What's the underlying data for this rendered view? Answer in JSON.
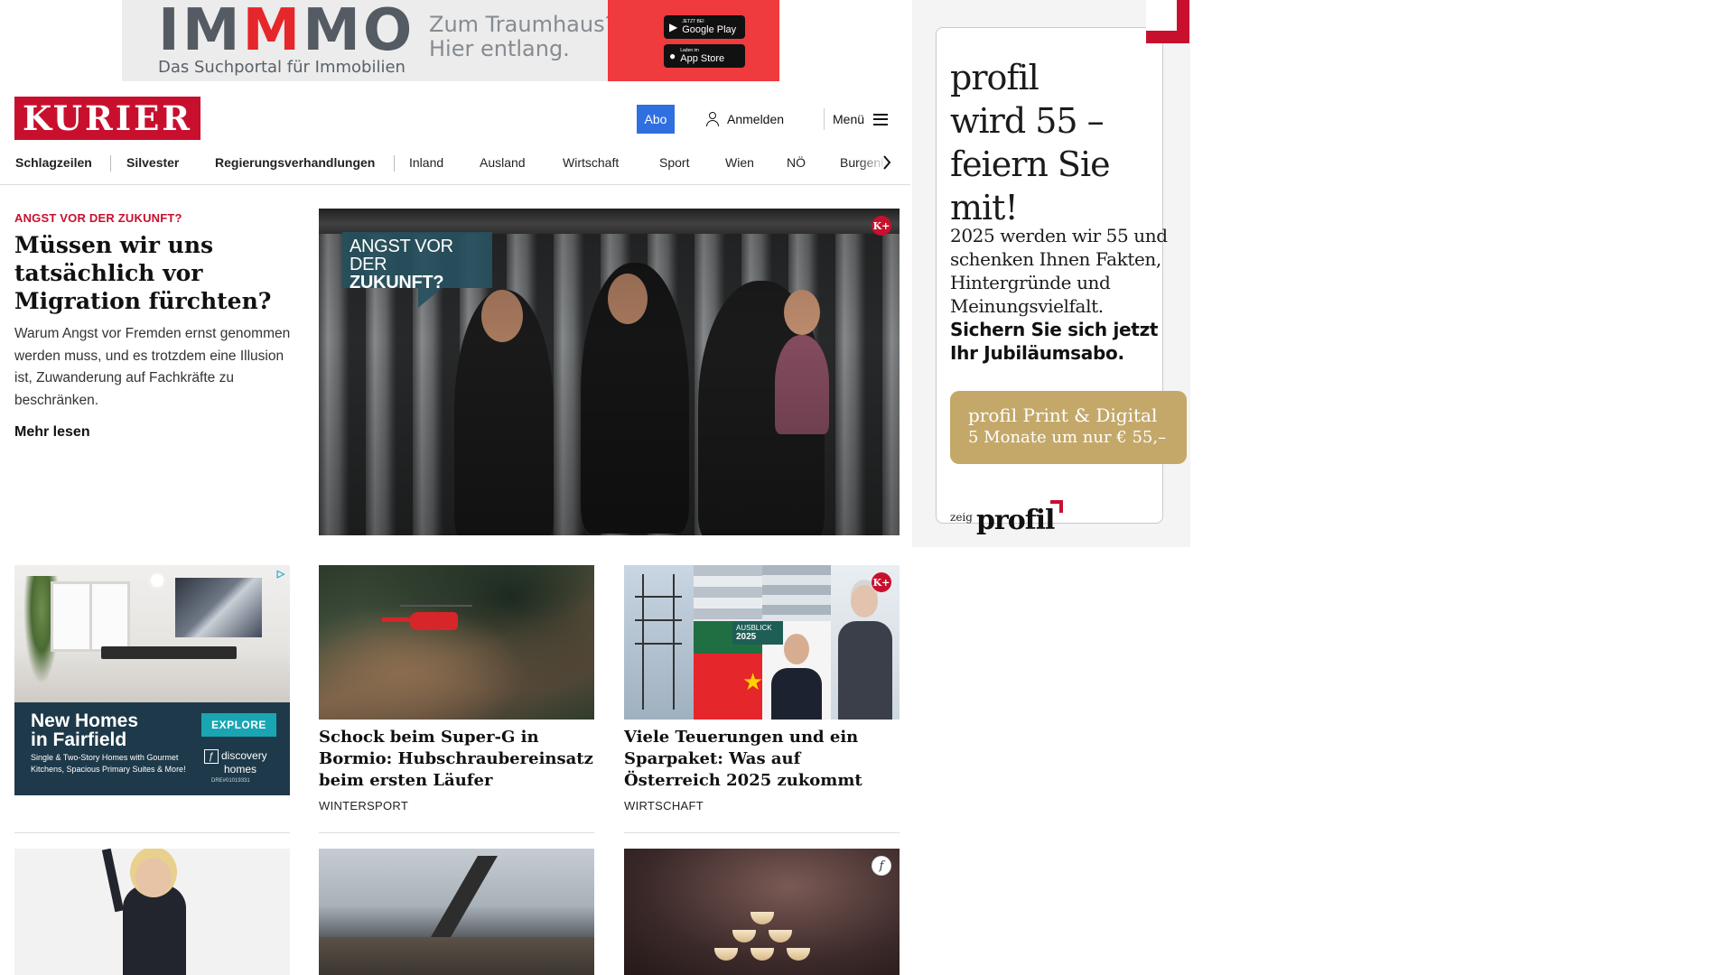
{
  "top_ad": {
    "logo_part1": "IM",
    "logo_part2": "M",
    "logo_part3": "MO",
    "subtitle": "Das Suchportal für Immobilien",
    "claim_line1": "Zum Traumhaus?",
    "claim_line2": "Hier entlang.",
    "google_play_small": "JETZT BEI",
    "google_play": "Google Play",
    "app_store_small": "Laden im",
    "app_store": "App Store"
  },
  "header": {
    "logo": "KURIER",
    "abo_label": "Abo",
    "login_label": "Anmelden",
    "menu_label": "Menü"
  },
  "nav": {
    "items": [
      "Schlagzeilen",
      "Silvester",
      "Regierungsverhandlungen",
      "Inland",
      "Ausland",
      "Wirtschaft",
      "Sport",
      "Wien",
      "NÖ",
      "Burgenland"
    ]
  },
  "lead": {
    "kicker": "ANGST VOR DER ZUKUNFT?",
    "title": "Müssen wir uns tatsäch­lich vor Migration fürchten?",
    "teaser": "Warum Angst vor Fremden ernst genommen werden muss, und es trotzdem eine Illusion ist, Zuwanderung auf Fachkräfte zu beschränken.",
    "more": "Mehr lesen",
    "image_label_line1": "ANGST VOR DER",
    "image_label_line2": "ZUKUNFT?",
    "badge": "K+"
  },
  "ad_card": {
    "headline_line1": "New Homes",
    "headline_line2": "in Fairfield",
    "small_text": "Single & Two-Story Homes with Gourmet Kitchens, Spacious Primary Suites & More!",
    "button": "EXPLORE",
    "brand_line1": "discovery",
    "brand_line2": "homes",
    "license": "DRE#01019331",
    "info_icon": "▷"
  },
  "cards": [
    {
      "title": "Schock beim Super-G in Bormio: Hubschraubereinsatz beim ersten Läufer",
      "category": "WINTERSPORT"
    },
    {
      "title": "Viele Teuerungen und ein Sparpa­ket: Was auf Österreich 2025 zukommt",
      "category": "WIRTSCHAFT",
      "badge": "K+",
      "image_label_line1": "AUSBLICK",
      "image_label_line2": "2025"
    }
  ],
  "row3": {
    "badge_f": "f"
  },
  "profil_ad": {
    "headline_line1": "profil",
    "headline_line2": "wird 55 –",
    "headline_line3": "feiern Sie mit!",
    "body": "2025 werden wir 55 und schenken Ihnen Fakten, Hintergründe und Meinungsvielfalt.",
    "body_bold": "Sichern Sie sich jetzt Ihr Jubiläumsabo.",
    "button_line1": "profil Print & Digital",
    "button_line2": "5 Monate um nur € 55,–",
    "footer_prefix": "zeig",
    "footer_logo": "profil"
  },
  "colors": {
    "kurier_red": "#c8102e",
    "abo_blue": "#2f6fe0",
    "profil_gold": "#c4a86a",
    "immmo_red": "#ef3a3e"
  }
}
